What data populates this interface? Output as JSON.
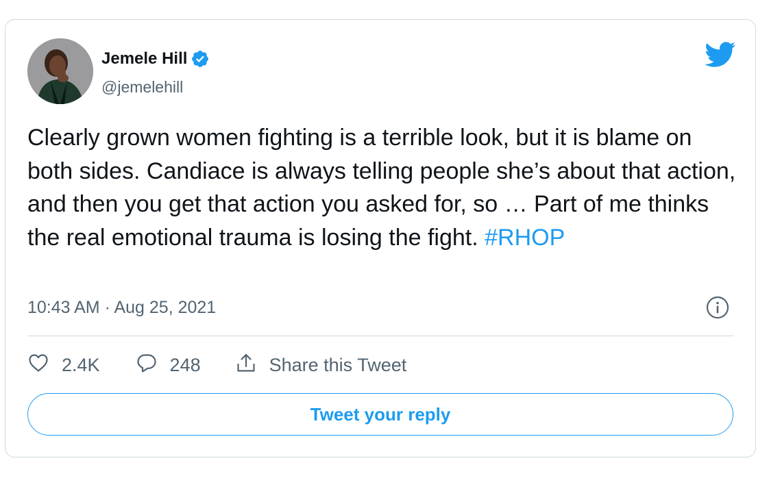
{
  "tweet": {
    "author": {
      "name": "Jemele Hill",
      "handle": "@jemelehill",
      "verified": true,
      "verified_color": "#1d9bf0"
    },
    "text_before_hashtag": "Clearly grown women fighting is a terrible look, but it is blame on both sides. Candiace is always telling people she’s about that action, and then you get that action you asked for, so … Part of me thinks the real emotional trauma is losing the fight. ",
    "hashtag": "#RHOP",
    "timestamp": "10:43 AM · Aug 25, 2021",
    "icons": {
      "brand": "twitter-bird-icon",
      "info": "info-icon",
      "like": "heart-icon",
      "reply": "speech-bubble-icon",
      "share": "share-upload-icon"
    }
  },
  "actions": {
    "like_count": "2.4K",
    "reply_count": "248",
    "share_label": "Share this Tweet"
  },
  "reply_button": {
    "label": "Tweet your reply"
  },
  "colors": {
    "accent": "#1d9bf0",
    "text_primary": "#0f1419",
    "text_secondary": "#536471",
    "border": "#cfd9de"
  }
}
